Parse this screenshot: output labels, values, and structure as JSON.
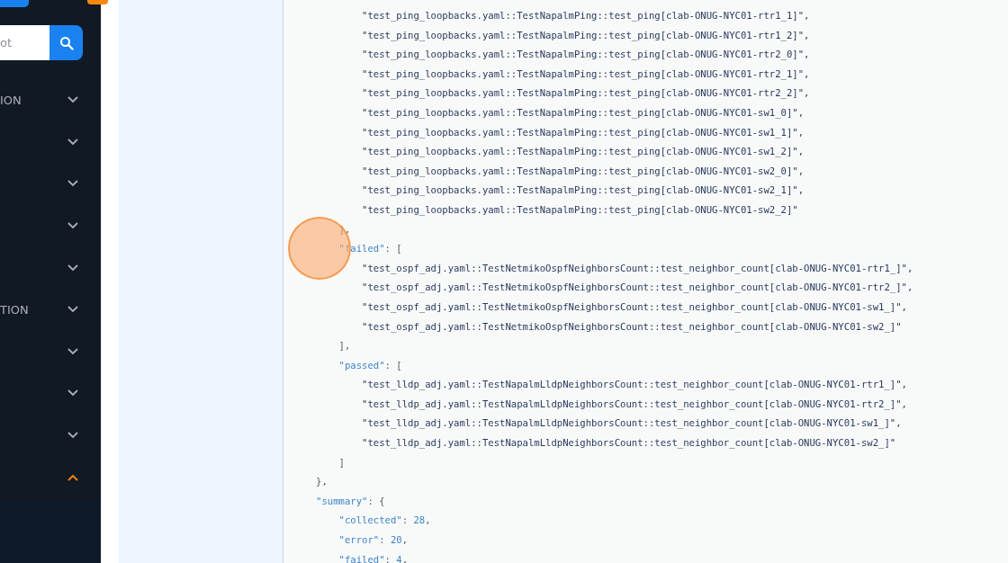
{
  "sidebar": {
    "search": {
      "placeholder": "ot"
    },
    "items": [
      {
        "label": "ION",
        "expanded": false
      },
      {
        "expanded": false
      },
      {
        "expanded": false
      },
      {
        "expanded": false
      },
      {
        "expanded": false
      },
      {
        "label": "TION",
        "expanded": false
      },
      {
        "expanded": false
      },
      {
        "expanded": false
      },
      {
        "expanded": false
      },
      {
        "expanded": true
      }
    ]
  },
  "code": [
    {
      "kind": "block",
      "children": [
        {
          "kind": "block",
          "children": [
            {
              "kind": "string",
              "text": "\"test_ping_loopbacks.yaml::TestNapalmPing::test_ping[clab-ONUG-NYC01-rtr1_1]\","
            },
            {
              "kind": "string",
              "text": "\"test_ping_loopbacks.yaml::TestNapalmPing::test_ping[clab-ONUG-NYC01-rtr1_2]\","
            },
            {
              "kind": "string",
              "text": "\"test_ping_loopbacks.yaml::TestNapalmPing::test_ping[clab-ONUG-NYC01-rtr2_0]\","
            },
            {
              "kind": "string",
              "text": "\"test_ping_loopbacks.yaml::TestNapalmPing::test_ping[clab-ONUG-NYC01-rtr2_1]\","
            },
            {
              "kind": "string",
              "text": "\"test_ping_loopbacks.yaml::TestNapalmPing::test_ping[clab-ONUG-NYC01-rtr2_2]\","
            },
            {
              "kind": "string",
              "text": "\"test_ping_loopbacks.yaml::TestNapalmPing::test_ping[clab-ONUG-NYC01-sw1_0]\","
            },
            {
              "kind": "string",
              "text": "\"test_ping_loopbacks.yaml::TestNapalmPing::test_ping[clab-ONUG-NYC01-sw1_1]\","
            },
            {
              "kind": "string",
              "text": "\"test_ping_loopbacks.yaml::TestNapalmPing::test_ping[clab-ONUG-NYC01-sw1_2]\","
            },
            {
              "kind": "string",
              "text": "\"test_ping_loopbacks.yaml::TestNapalmPing::test_ping[clab-ONUG-NYC01-sw2_0]\","
            },
            {
              "kind": "string",
              "text": "\"test_ping_loopbacks.yaml::TestNapalmPing::test_ping[clab-ONUG-NYC01-sw2_1]\","
            },
            {
              "kind": "string",
              "text": "\"test_ping_loopbacks.yaml::TestNapalmPing::test_ping[clab-ONUG-NYC01-sw2_2]\""
            }
          ],
          "close": "],"
        },
        {
          "kind": "block",
          "key": "\"failed\"",
          "open": ": [",
          "children": [
            {
              "kind": "string",
              "text": "\"test_ospf_adj.yaml::TestNetmikoOspfNeighborsCount::test_neighbor_count[clab-ONUG-NYC01-rtr1_]\","
            },
            {
              "kind": "string",
              "text": "\"test_ospf_adj.yaml::TestNetmikoOspfNeighborsCount::test_neighbor_count[clab-ONUG-NYC01-rtr2_]\","
            },
            {
              "kind": "string",
              "text": "\"test_ospf_adj.yaml::TestNetmikoOspfNeighborsCount::test_neighbor_count[clab-ONUG-NYC01-sw1_]\","
            },
            {
              "kind": "string",
              "text": "\"test_ospf_adj.yaml::TestNetmikoOspfNeighborsCount::test_neighbor_count[clab-ONUG-NYC01-sw2_]\""
            }
          ],
          "close": "],"
        },
        {
          "kind": "block",
          "key": "\"passed\"",
          "open": ": [",
          "children": [
            {
              "kind": "string",
              "text": "\"test_lldp_adj.yaml::TestNapalmLldpNeighborsCount::test_neighbor_count[clab-ONUG-NYC01-rtr1_]\","
            },
            {
              "kind": "string",
              "text": "\"test_lldp_adj.yaml::TestNapalmLldpNeighborsCount::test_neighbor_count[clab-ONUG-NYC01-rtr2_]\","
            },
            {
              "kind": "string",
              "text": "\"test_lldp_adj.yaml::TestNapalmLldpNeighborsCount::test_neighbor_count[clab-ONUG-NYC01-sw1_]\","
            },
            {
              "kind": "string",
              "text": "\"test_lldp_adj.yaml::TestNapalmLldpNeighborsCount::test_neighbor_count[clab-ONUG-NYC01-sw2_]\""
            }
          ],
          "close": "]"
        }
      ],
      "close": "},"
    },
    {
      "kind": "block",
      "key": "\"summary\"",
      "open": ": {",
      "children": [
        {
          "kind": "pair",
          "key": "\"collected\"",
          "sep": ": ",
          "value": "28",
          "punct": ","
        },
        {
          "kind": "pair",
          "key": "\"error\"",
          "sep": ": ",
          "value": "20",
          "punct": ","
        },
        {
          "kind": "pair",
          "key": "\"failed\"",
          "sep": ": ",
          "value": "4",
          "punct": ","
        }
      ]
    }
  ]
}
